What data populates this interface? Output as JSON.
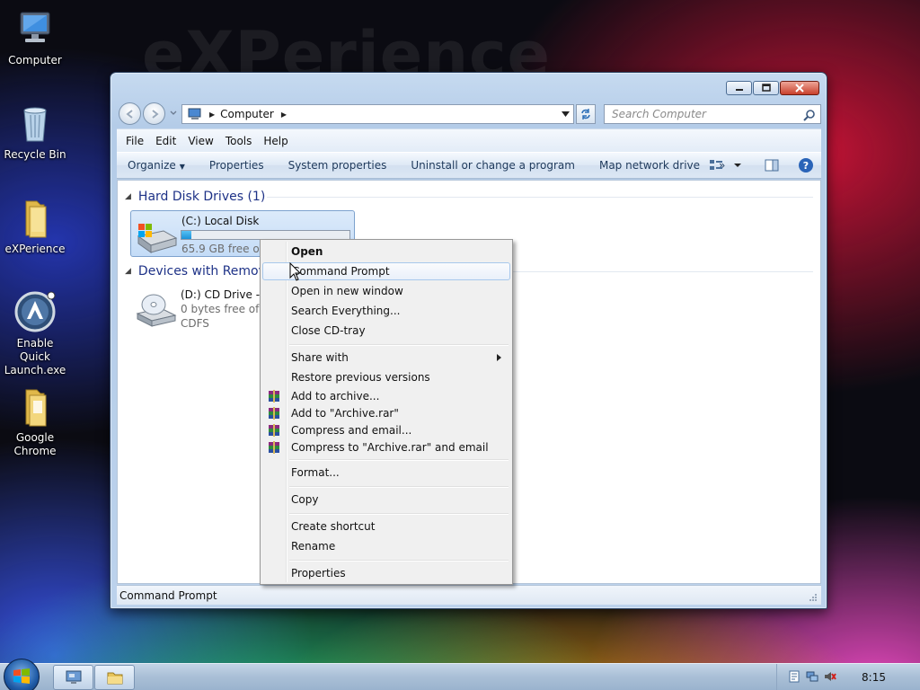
{
  "wallpaper": {
    "text": "eXPerience"
  },
  "desktop_icons": [
    {
      "label": "Computer",
      "icon": "computer-icon"
    },
    {
      "label": "Recycle Bin",
      "icon": "recycle-bin-icon"
    },
    {
      "label": "eXPerience",
      "icon": "folder-icon"
    },
    {
      "label": "Enable Quick Launch.exe",
      "icon": "app-icon"
    },
    {
      "label": "Google Chrome",
      "icon": "folder-icon"
    }
  ],
  "window": {
    "address": {
      "crumb": "Computer"
    },
    "search": {
      "placeholder": "Search Computer"
    },
    "menubar": [
      "File",
      "Edit",
      "View",
      "Tools",
      "Help"
    ],
    "commands": {
      "organize": "Organize",
      "properties": "Properties",
      "system_properties": "System properties",
      "uninstall": "Uninstall or change a program",
      "map_drive": "Map network drive",
      "overflow": "»"
    },
    "groups": {
      "hdd": "Hard Disk Drives (1)",
      "removable": "Devices with Removable Storage (1)"
    },
    "drives": {
      "c": {
        "name": "(C:) Local Disk",
        "free": "65.9 GB free of 69.9 GB",
        "used_fraction": 0.06
      },
      "d": {
        "name": "(D:) CD Drive - vista_sp2",
        "free": "0 bytes free of 50.2 MB",
        "fs": "CDFS"
      }
    },
    "status": "Command Prompt"
  },
  "context_menu": {
    "items": [
      {
        "label": "Open",
        "bold": true
      },
      {
        "label": "Command Prompt",
        "hover": true
      },
      {
        "label": "Open in new window"
      },
      {
        "label": "Search Everything..."
      },
      {
        "label": "Close CD-tray"
      },
      {
        "label": "Share with",
        "submenu": true
      },
      {
        "label": "Restore previous versions"
      },
      {
        "label": "Add to archive...",
        "icon": "winrar-icon"
      },
      {
        "label": "Add to \"Archive.rar\"",
        "icon": "winrar-icon"
      },
      {
        "label": "Compress and email...",
        "icon": "winrar-icon"
      },
      {
        "label": "Compress to \"Archive.rar\" and email",
        "icon": "winrar-icon"
      },
      {
        "label": "Format..."
      },
      {
        "label": "Copy"
      },
      {
        "label": "Create shortcut"
      },
      {
        "label": "Rename"
      },
      {
        "label": "Properties"
      }
    ]
  },
  "taskbar": {
    "clock": "8:15"
  },
  "colors": {
    "group_heading": "#1e3287",
    "drive_bar": "#1b91d8",
    "selection": "#c4dcf7"
  }
}
